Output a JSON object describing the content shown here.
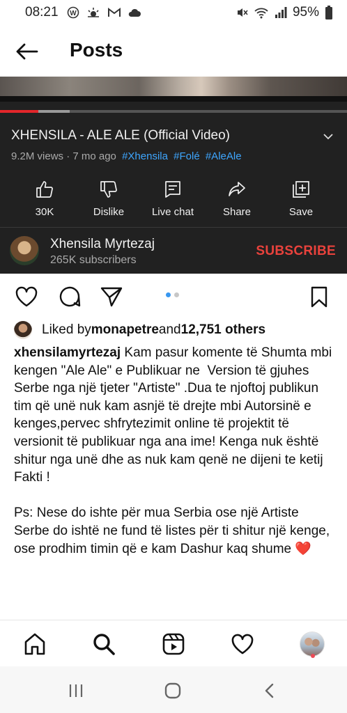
{
  "status_bar": {
    "time": "08:21",
    "battery": "95%",
    "icons": [
      "wordpress-icon",
      "weather-icon",
      "gmail-icon",
      "cloud-icon",
      "mute-icon",
      "wifi-icon",
      "signal-icon",
      "battery-icon"
    ]
  },
  "header": {
    "title": "Posts"
  },
  "video": {
    "title": "XHENSILA - ALE ALE (Official Video)",
    "views": "9.2M views · 7 mo ago",
    "hashtags": [
      "#Xhensila",
      "#Folé",
      "#AleAle"
    ],
    "progress": 0.11,
    "buffer": 0.2,
    "actions": [
      {
        "label": "30K",
        "icon": "thumbs-up-icon"
      },
      {
        "label": "Dislike",
        "icon": "thumbs-down-icon"
      },
      {
        "label": "Live chat",
        "icon": "chat-icon"
      },
      {
        "label": "Share",
        "icon": "share-icon"
      },
      {
        "label": "Save",
        "icon": "save-playlist-icon"
      }
    ],
    "channel": {
      "name": "Xhensila Myrtezaj",
      "subscribers": "265K subscribers",
      "subscribe_label": "SUBSCRIBE"
    }
  },
  "post": {
    "liked_by_prefix": "Liked by ",
    "liked_by_user": "monapetre",
    "liked_by_middle": " and ",
    "liked_by_count": "12,751 others",
    "carousel_active": 0,
    "caption_user": "xhensilamyrtezaj",
    "caption_text": " Kam pasur komente të Shumta mbi kengen \"Ale Ale\" e Publikuar ne  Version të gjuhes Serbe nga një tjeter \"Artiste\" .Dua te njoftoj publikun tim që unë nuk kam asnjë të drejte mbi Autorsinë e kenges,pervec shfrytezimit online të projektit të versionit të publikuar nga ana ime! Kenga nuk është shitur nga unë dhe as nuk kam qenë ne dijeni te ketij Fakti !\n\nPs: Nese do ishte për mua Serbia ose një Artiste Serbe do ishtë ne fund të listes për ti shitur një kenge, ose prodhim timin që e kam Dashur kaq shume ",
    "caption_emoji": "❤️"
  },
  "colors": {
    "video_bg": "#212121",
    "progress": "#e3262b",
    "hashtag": "#3ea6ff",
    "subscribe": "#e9423c",
    "dot_active": "#3897f0",
    "dot_inactive": "#c7c7c7",
    "notification": "#ed4956"
  }
}
